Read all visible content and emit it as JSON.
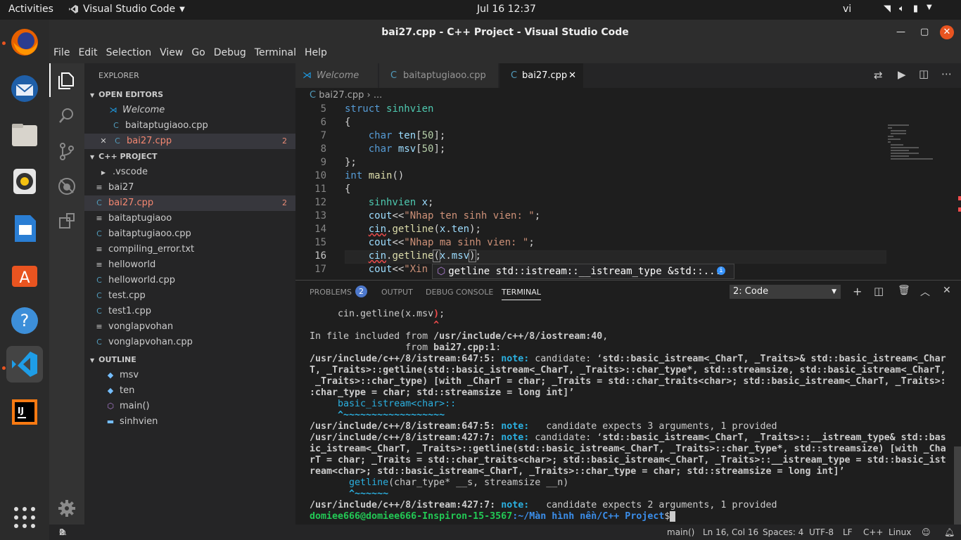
{
  "topbar": {
    "activities": "Activities",
    "app_name": "Visual Studio Code",
    "clock": "Jul 16  12:37",
    "lang": "vi"
  },
  "window": {
    "title": "bai27.cpp - C++ Project - Visual Studio Code"
  },
  "menu": [
    "File",
    "Edit",
    "Selection",
    "View",
    "Go",
    "Debug",
    "Terminal",
    "Help"
  ],
  "sidebar": {
    "title": "EXPLORER",
    "open_editors_header": "OPEN EDITORS",
    "open_editors": [
      {
        "label": "Welcome"
      },
      {
        "label": "baitaptugiaoo.cpp"
      },
      {
        "label": "bai27.cpp",
        "badge": "2"
      }
    ],
    "project_header": "C++ PROJECT",
    "files": [
      ".vscode",
      "bai27",
      "bai27.cpp",
      "baitaptugiaoo",
      "baitaptugiaoo.cpp",
      "compiling_error.txt",
      "helloworld",
      "helloworld.cpp",
      "test.cpp",
      "test1.cpp",
      "vonglapvohan",
      "vonglapvohan.cpp"
    ],
    "file_badge": "2",
    "outline_header": "OUTLINE",
    "outline": [
      "msv",
      "ten",
      "main()",
      "sinhvien"
    ]
  },
  "tabs": [
    {
      "label": "Welcome"
    },
    {
      "label": "baitaptugiaoo.cpp"
    },
    {
      "label": "bai27.cpp"
    }
  ],
  "breadcrumb": {
    "file": "bai27.cpp",
    "more": "..."
  },
  "code": {
    "line_numbers": [
      "5",
      "6",
      "7",
      "8",
      "9",
      "10",
      "11",
      "12",
      "13",
      "14",
      "15",
      "16",
      "17"
    ],
    "lines": [
      "struct sinhvien",
      "{",
      "    char ten[50];",
      "    char msv[50];",
      "};",
      "int main()",
      "{",
      "    sinhvien x;",
      "    cout<<\"Nhap ten sinh vien: \";",
      "    cin.getline(x.ten);",
      "    cout<<\"Nhap ma sinh vien: \";",
      "    cin.getline(x.msv);",
      "    cout<<\"Xin"
    ],
    "hint": "getline  std::istream::__istream_type &std::..."
  },
  "panel": {
    "tabs": [
      "PROBLEMS",
      "OUTPUT",
      "DEBUG CONSOLE",
      "TERMINAL"
    ],
    "problems_count": "2",
    "terminal_select": "2: Code",
    "terminal_lines": [
      "     cin.getline(x.msv);",
      "                      ^",
      "In file included from /usr/include/c++/8/iostream:40,",
      "                 from bai27.cpp:1:",
      "/usr/include/c++/8/istream:647:5: note: candidate: ‘std::basic_istream<_CharT, _Traits>& std::basic_istream<_Char",
      "T, _Traits>::getline(std::basic_istream<_CharT, _Traits>::char_type*, std::streamsize, std::basic_istream<_CharT,",
      " _Traits>::char_type) [with _CharT = char; _Traits = std::char_traits<char>; std::basic_istream<_CharT, _Traits>:",
      ":char_type = char; std::streamsize = long int]’",
      "     basic_istream<char>::",
      "     ^~~~~~~~~~~~~~~~~~~",
      "/usr/include/c++/8/istream:647:5: note:   candidate expects 3 arguments, 1 provided",
      "/usr/include/c++/8/istream:427:7: note: candidate: ‘std::basic_istream<_CharT, _Traits>::__istream_type& std::bas",
      "ic_istream<_CharT, _Traits>::getline(std::basic_istream<_CharT, _Traits>::char_type*, std::streamsize) [with _Cha",
      "rT = char; _Traits = std::char_traits<char>; std::basic_istream<_CharT, _Traits>::__istream_type = std::basic_ist",
      "ream<char>; std::basic_istream<_CharT, _Traits>::char_type = char; std::streamsize = long int]’",
      "       getline(char_type* __s, streamsize __n)",
      "       ^~~~~~~",
      "/usr/include/c++/8/istream:427:7: note:   candidate expects 2 arguments, 1 provided"
    ],
    "prompt_user": "domiee666@domiee666-Inspiron-15-3567",
    "prompt_path": ":~/Màn hình nền/C++ Project",
    "prompt_end": "$"
  },
  "status": {
    "errors": "2",
    "warnings": "0",
    "func": "main()",
    "position": "Ln 16, Col 16",
    "spaces": "Spaces: 4",
    "encoding": "UTF-8",
    "eol": "LF",
    "language": "C++",
    "os": "Linux"
  },
  "colors": {
    "accent": "#007acc",
    "error": "#f48771",
    "ubuntu_orange": "#e95420"
  }
}
